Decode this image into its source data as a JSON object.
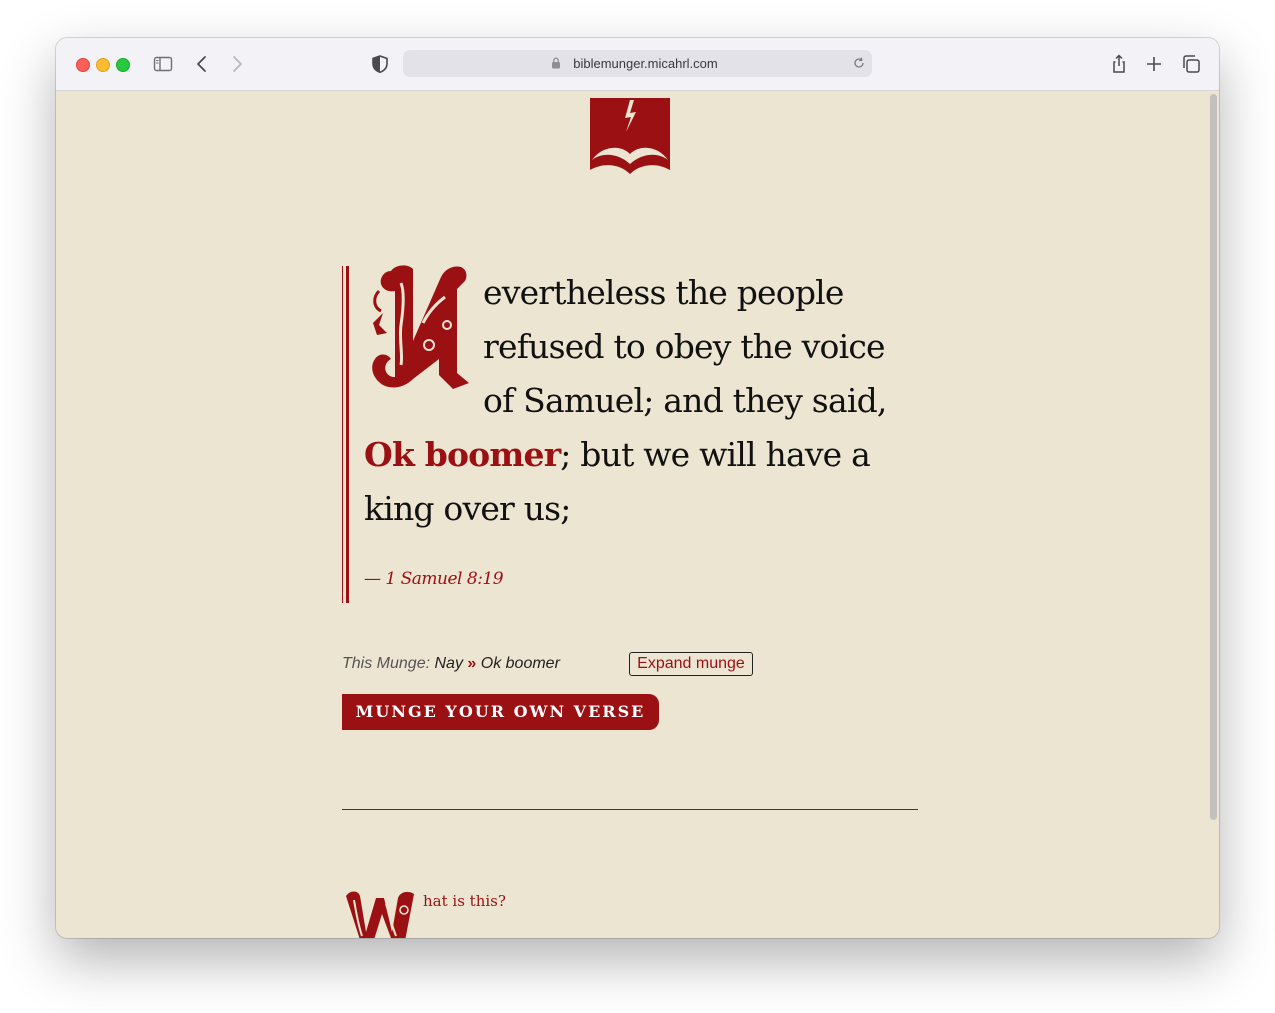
{
  "browser": {
    "url": "biblemunger.micahrl.com"
  },
  "verse": {
    "dropcap_letter": "N",
    "text_before": "evertheless the people refused to obey the voice of Samuel; and they said, ",
    "highlight": "Ok boomer",
    "text_after": "; but we will have a king over us;",
    "citation": "— 1 Samuel 8:19"
  },
  "munge": {
    "label": "This Munge:",
    "original": "Nay",
    "separator": "»",
    "replacement": "Ok boomer",
    "expand_label": "Expand munge"
  },
  "cta": {
    "label": "MUNGE YOUR OWN VERSE"
  },
  "about": {
    "dropcap_letter": "W",
    "heading_rest": "hat is this?"
  },
  "colors": {
    "accent": "#9b1013",
    "page_background": "#ece5d2"
  },
  "icons": [
    "sidebar-icon",
    "back-icon",
    "forward-icon",
    "privacy-shield-icon",
    "lock-icon",
    "reload-icon",
    "share-icon",
    "new-tab-icon",
    "tabs-overview-icon",
    "bible-logo-icon"
  ]
}
